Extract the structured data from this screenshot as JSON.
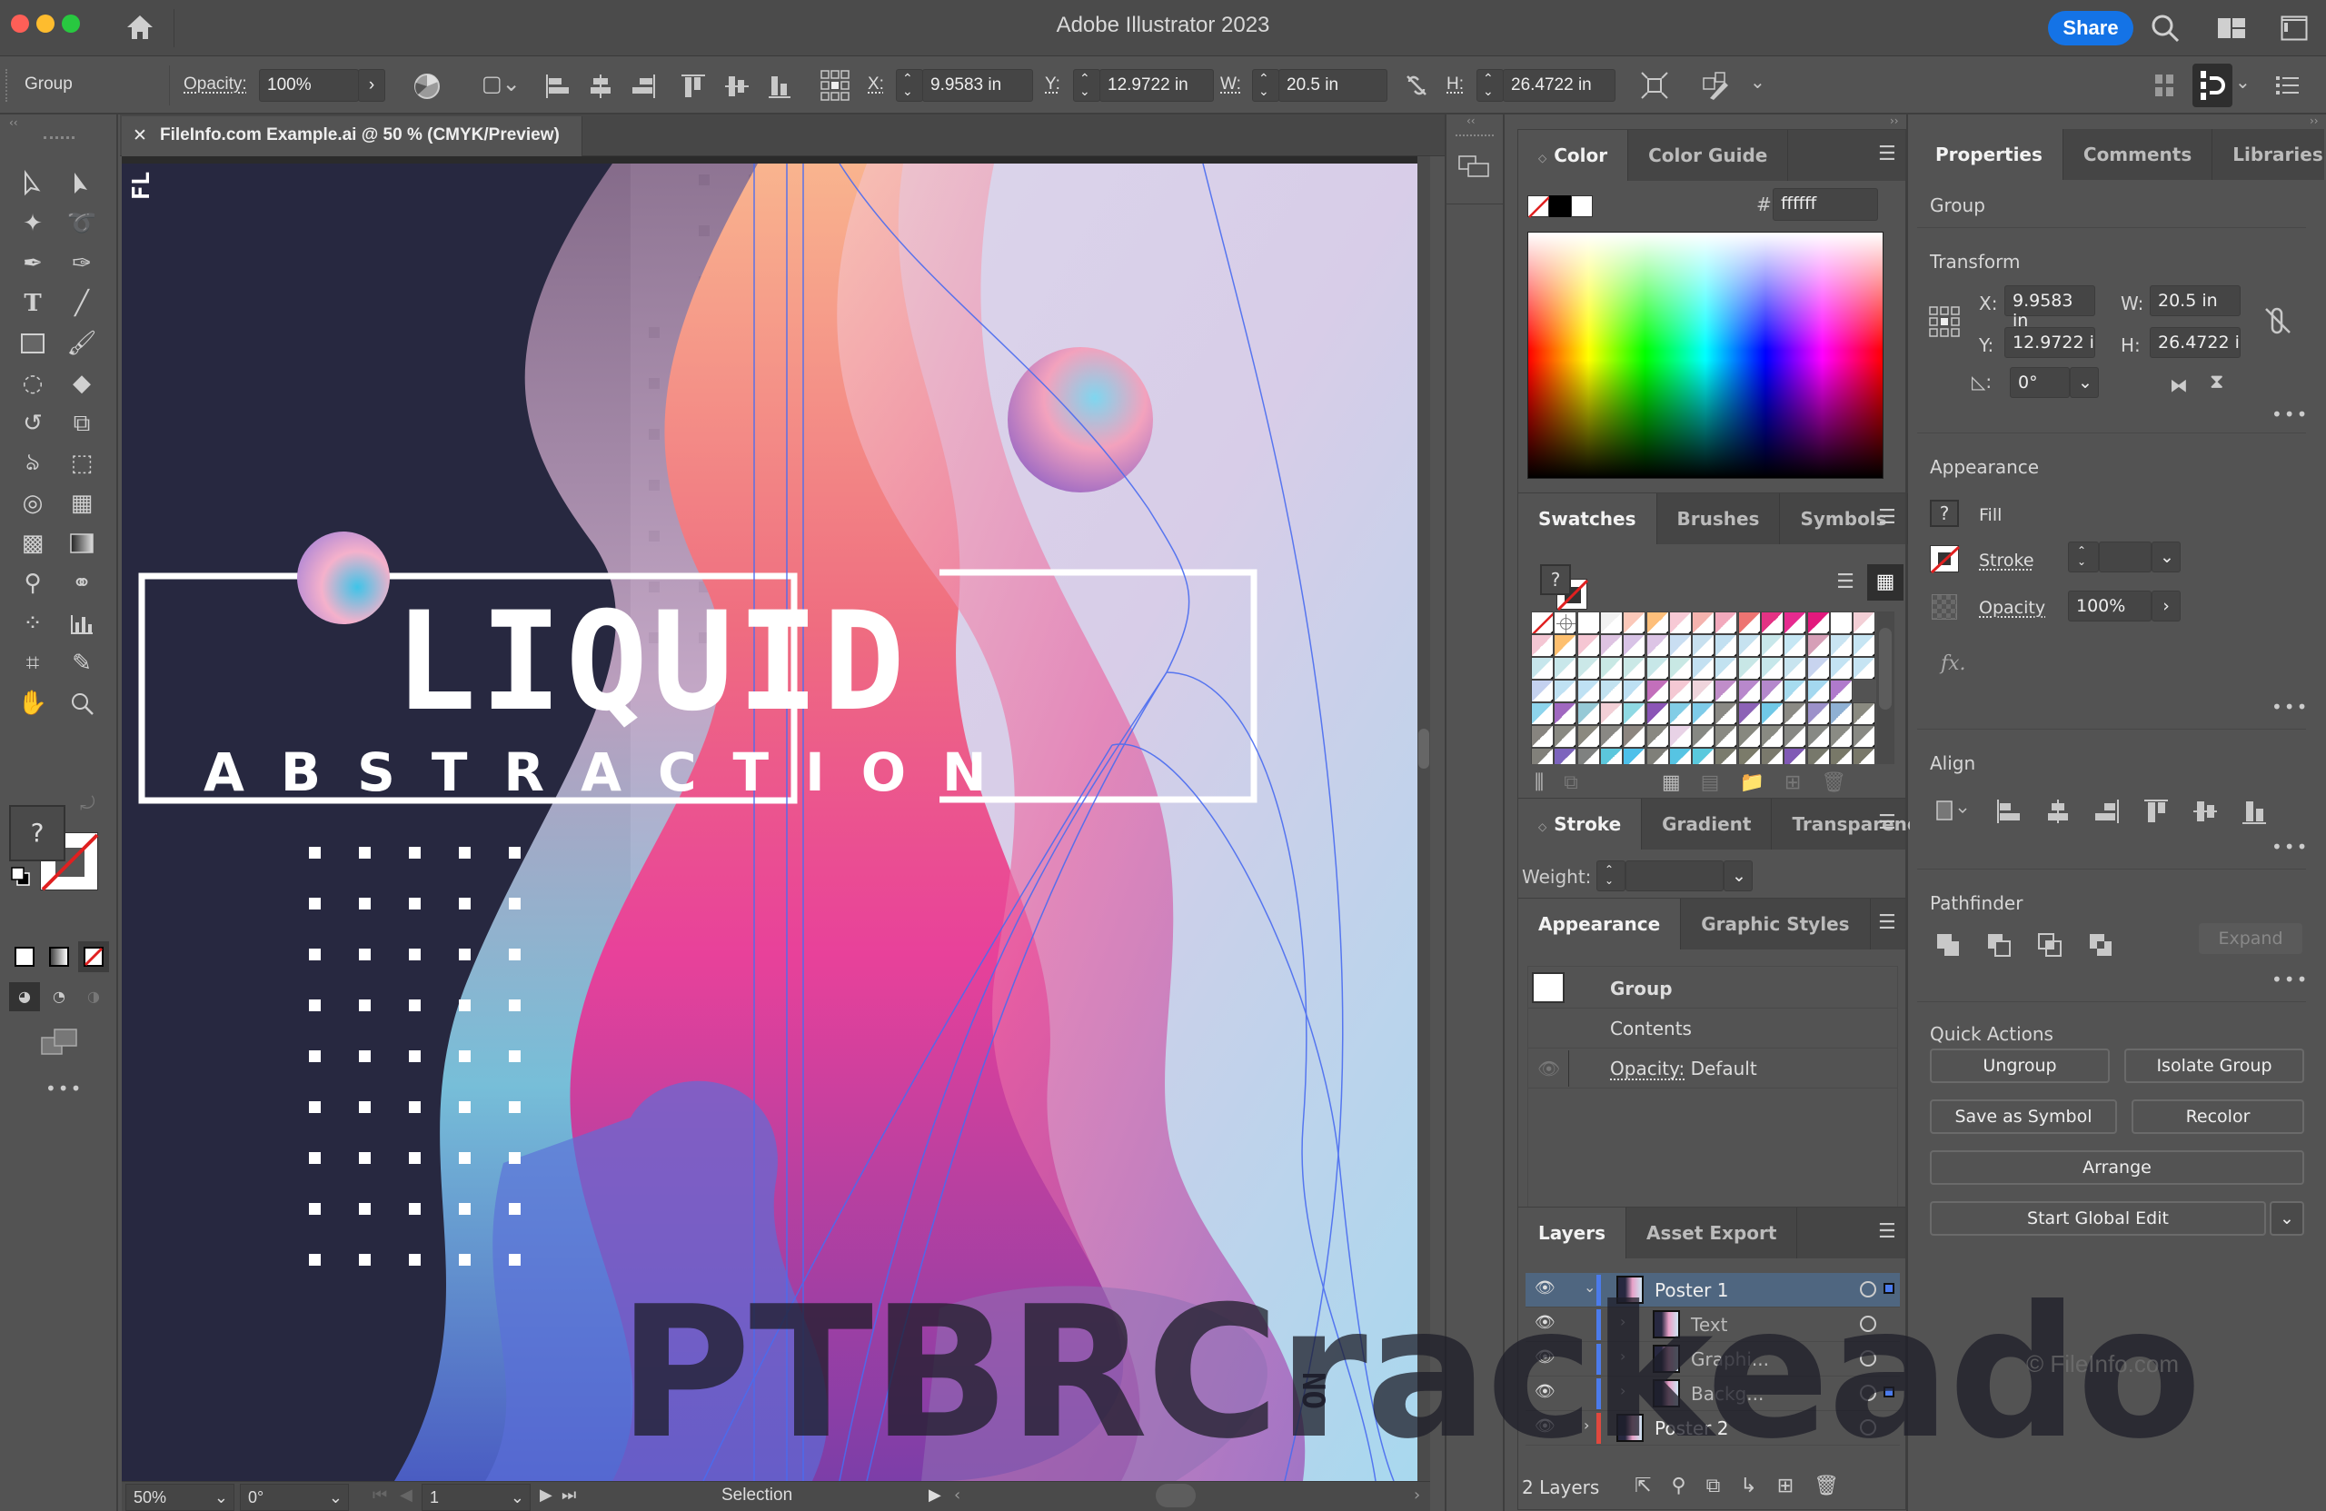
{
  "window": {
    "title": "Adobe Illustrator 2023",
    "share_label": "Share",
    "traffic_colors": [
      "#fe5f57",
      "#febc2e",
      "#28c840"
    ]
  },
  "control_bar": {
    "selection_type": "Group",
    "opacity_label": "Opacity:",
    "opacity_value": "100%",
    "x_label": "X:",
    "x_value": "9.9583 in",
    "y_label": "Y:",
    "y_value": "12.9722 in",
    "w_label": "W:",
    "w_value": "20.5 in",
    "h_label": "H:",
    "h_value": "26.4722 in"
  },
  "document": {
    "tab_title": "FileInfo.com Example.ai @ 50 % (CMYK/Preview)",
    "close_glyph": "✕"
  },
  "artwork": {
    "headline": "LIQUID",
    "subhead": "ABSTRACTION",
    "side_text_top": "FL",
    "side_text_bottom": "NO",
    "bg_dark": "#272840"
  },
  "status_bar": {
    "zoom": "50%",
    "rotation": "0°",
    "artboard": "1",
    "tool": "Selection"
  },
  "color_panel": {
    "tabs": [
      "Color",
      "Color Guide"
    ],
    "hash": "#",
    "hex_value": "ffffff"
  },
  "swatches_panel": {
    "tabs": [
      "Swatches",
      "Brushes",
      "Symbols"
    ],
    "fill_glyph": "?",
    "rows": [
      [
        "#ffffff",
        "#eeeeee",
        "#ffffff",
        "#f1f1f1",
        "#fbc8b9",
        "#fdbf7b",
        "#f7c9d5",
        "#f4b3ae",
        "#f2a9bc",
        "#ed7472",
        "#e33384",
        "#e62b8f",
        "#e2197d",
        "#ffffff",
        "#f3cfd6"
      ],
      [
        "#f4c6d3",
        "#fdbf6f",
        "#f5c6d3",
        "#dec3e2",
        "#d8c3e6",
        "#dcc4e5",
        "#c9def2",
        "#c7e0ef",
        "#c2e0f1",
        "#c6e2f0",
        "#c8e7ea",
        "#c6e7f4",
        "#d69fb7",
        "#c9e4f2",
        "#c6e5f3"
      ],
      [
        "#c6e6ec",
        "#c8e7ea",
        "#cbe8e8",
        "#c8e8e4",
        "#cae8e6",
        "#c7e7e8",
        "#c8e8e4",
        "#c3e0f1",
        "#c2e2f0",
        "#c8e7e6",
        "#c6e7ea",
        "#c8e4ef",
        "#c8d4ef",
        "#c3e3f3",
        "#c6e4f3"
      ],
      [
        "#c4d1ef",
        "#bfe1f3",
        "#bfe1f3",
        "#c2e2f0",
        "#bde0f3",
        "#c26fbb",
        "#f4c8d3",
        "#efd4dc",
        "#c08dc9",
        "#b888cc",
        "#b488cc",
        "#a6dbef",
        "#a4d8ef",
        "#b07acc"
      ],
      [
        "#8dd4ec",
        "#a068c0",
        "#96c9d6",
        "#f2cfd6",
        "#8fd9e3",
        "#8b55b6",
        "#82cde6",
        "#7ecbe8",
        "#8a8984",
        "#8c62b6",
        "#70c8e6",
        "#8b8a84",
        "#9c91ca",
        "#8fb0d3",
        "#8a8a80"
      ],
      [
        "#87847f",
        "#898982",
        "#8b897f",
        "#898884",
        "#8c857f",
        "#898881",
        "#e8d2e6",
        "#868883",
        "#898982",
        "#87887f",
        "#898a82",
        "#878884",
        "#878984",
        "#8a8b84",
        "#888983"
      ],
      [
        "#81807a",
        "#7c64bd",
        "#7f8180",
        "#5cc7dc",
        "#4dc0ea",
        "#7f7f79",
        "#56c4e3",
        "#5ac9dd",
        "#7a7b6d",
        "#7b7b6a",
        "#7a796c",
        "#8059b5",
        "#77786b",
        "#787868",
        "#797869"
      ]
    ]
  },
  "stroke_panel": {
    "tabs": [
      "Stroke",
      "Gradient",
      "Transparency"
    ],
    "weight_label": "Weight:",
    "weight_value": ""
  },
  "appearance_panel": {
    "tabs": [
      "Appearance",
      "Graphic Styles"
    ],
    "rows": [
      {
        "label": "Group"
      },
      {
        "label": "Contents"
      },
      {
        "label": "Opacity:",
        "value": "Default"
      }
    ]
  },
  "layers_panel": {
    "tabs": [
      "Layers",
      "Asset Export"
    ],
    "rows": [
      {
        "name": "Poster 1",
        "expanded": true,
        "level": 0,
        "color": "#4b7bec",
        "selected": true,
        "has_selection": true
      },
      {
        "name": "Text",
        "expanded": false,
        "level": 1,
        "color": "#4b7bec",
        "selected": false,
        "has_selection": false
      },
      {
        "name": "Graphi...",
        "expanded": false,
        "level": 1,
        "color": "#4b7bec",
        "selected": false,
        "has_selection": false
      },
      {
        "name": "Backg...",
        "expanded": false,
        "level": 1,
        "color": "#4b7bec",
        "selected": false,
        "has_selection": true
      },
      {
        "name": "Poster 2",
        "expanded": false,
        "level": 0,
        "color": "#e0483e",
        "selected": false,
        "has_selection": false
      }
    ],
    "count_label": "2 Layers"
  },
  "properties_panel": {
    "tabs": [
      "Properties",
      "Comments",
      "Libraries"
    ],
    "selection_type": "Group",
    "transform": {
      "title": "Transform",
      "x_label": "X:",
      "x_value": "9.9583 in",
      "y_label": "Y:",
      "y_value": "12.9722 i",
      "w_label": "W:",
      "w_value": "20.5 in",
      "h_label": "H:",
      "h_value": "26.4722 i",
      "angle_value": "0°"
    },
    "appearance": {
      "title": "Appearance",
      "fill_label": "Fill",
      "fill_glyph": "?",
      "stroke_label": "Stroke",
      "stroke_value": "",
      "opacity_label": "Opacity",
      "opacity_value": "100%",
      "fx_label": "fx."
    },
    "align": {
      "title": "Align"
    },
    "pathfinder": {
      "title": "Pathfinder",
      "expand_label": "Expand"
    },
    "quick_actions": {
      "title": "Quick Actions",
      "ungroup": "Ungroup",
      "isolate_group": "Isolate Group",
      "save_as_symbol": "Save as Symbol",
      "recolor": "Recolor",
      "arrange": "Arrange",
      "start_global_edit": "Start Global Edit"
    }
  },
  "watermark": {
    "text": "PTBRCrackeado",
    "fileinfo": "© FileInfo.com"
  }
}
